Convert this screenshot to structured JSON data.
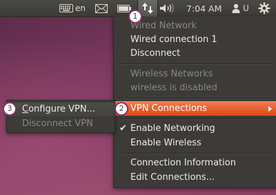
{
  "panel": {
    "language": "en",
    "clock": "7:04 AM",
    "user": "U",
    "icons": [
      "keyboard-icon",
      "mail-icon",
      "battery-icon",
      "network-icon",
      "volume-icon",
      "user-icon",
      "gear-icon"
    ]
  },
  "callouts": [
    "1",
    "2",
    "3"
  ],
  "menu": {
    "wired_header": "Wired Network",
    "wired_connection": "Wired connection 1",
    "disconnect": "Disconnect",
    "wireless_header": "Wireless Networks",
    "wireless_status": "wireless is disabled",
    "vpn": "VPN Connections",
    "enable_networking": "Enable Networking",
    "enable_wireless": "Enable Wireless",
    "connection_info": "Connection Information",
    "edit_connections": "Edit Connections..."
  },
  "submenu": {
    "configure_first": "C",
    "configure_rest": "onfigure VPN...",
    "disconnect_vpn": "Disconnect VPN"
  },
  "colors": {
    "highlight": "#dd4814",
    "menu_bg": "#3c3b37",
    "callout_border": "#8a2f6f"
  }
}
